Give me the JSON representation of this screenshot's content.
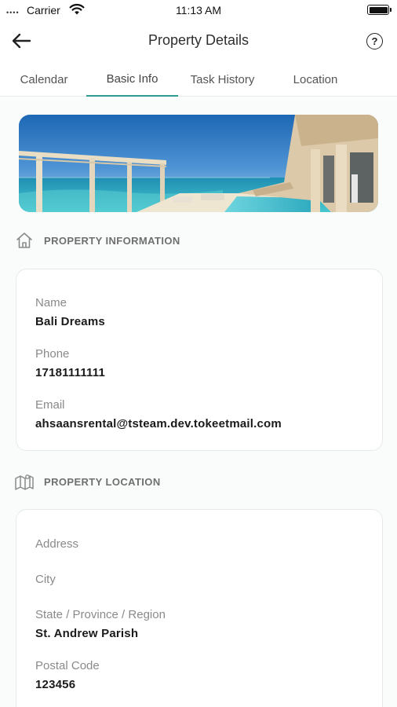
{
  "status_bar": {
    "signal": "••••",
    "carrier": "Carrier",
    "time": "11:13 AM"
  },
  "header": {
    "title": "Property Details",
    "back_icon": "arrow-left-icon",
    "help_icon": "help-circle-icon",
    "help_glyph": "?"
  },
  "tabs": [
    {
      "label": "Calendar",
      "active": false
    },
    {
      "label": "Basic Info",
      "active": true
    },
    {
      "label": "Task History",
      "active": false
    },
    {
      "label": "Location",
      "active": false
    }
  ],
  "accent_color": "#2a9d8f",
  "property_information": {
    "title": "PROPERTY INFORMATION",
    "icon": "home-icon",
    "fields": [
      {
        "label": "Name",
        "value": "Bali Dreams"
      },
      {
        "label": "Phone",
        "value": "17181111111"
      },
      {
        "label": "Email",
        "value": "ahsaansrental@tsteam.dev.tokeetmail.com"
      }
    ]
  },
  "property_location": {
    "title": "PROPERTY LOCATION",
    "icon": "map-icon",
    "fields": [
      {
        "label": "Address",
        "value": ""
      },
      {
        "label": "City",
        "value": ""
      },
      {
        "label": "State / Province / Region",
        "value": "St. Andrew Parish"
      },
      {
        "label": "Postal Code",
        "value": "123456"
      }
    ]
  }
}
